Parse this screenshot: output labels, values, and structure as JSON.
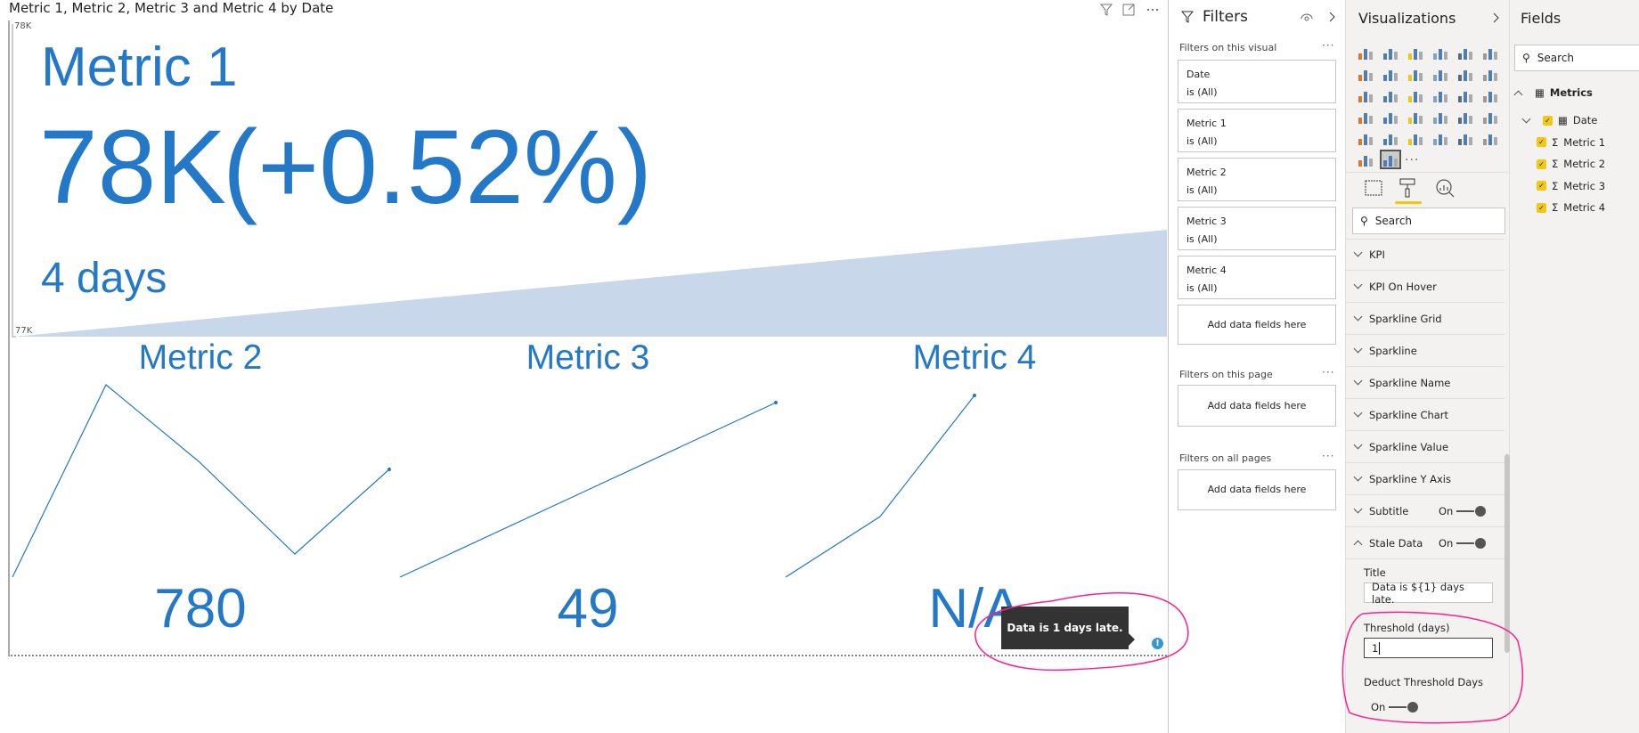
{
  "visual": {
    "title": "Metric 1, Metric 2, Metric 3 and Metric 4 by Date",
    "header_icons": [
      "filter-icon",
      "focus-mode-icon",
      "more-options-icon"
    ],
    "main_kpi": {
      "name": "Metric 1",
      "value": "78K",
      "change": "(+0.52%)",
      "subtitle": "4 days",
      "axis_max": "78K",
      "axis_min": "77K"
    },
    "sparklines": [
      {
        "name": "Metric 2",
        "value": "780"
      },
      {
        "name": "Metric 3",
        "value": "49"
      },
      {
        "name": "Metric 4",
        "value": "N/A"
      }
    ],
    "tooltip": "Data is 1 days late.",
    "stale_icon": "info-icon",
    "accent_color": "#2378c8",
    "area_color": "#c8d8ea",
    "annotation_color": "#ff1e8c"
  },
  "filters": {
    "title": "Filters",
    "on_visual_label": "Filters on this visual",
    "cards": [
      {
        "field": "Date",
        "state": "is (All)"
      },
      {
        "field": "Metric 1",
        "state": "is (All)"
      },
      {
        "field": "Metric 2",
        "state": "is (All)"
      },
      {
        "field": "Metric 3",
        "state": "is (All)"
      },
      {
        "field": "Metric 4",
        "state": "is (All)"
      }
    ],
    "add_fields": "Add data fields here",
    "on_page_label": "Filters on this page",
    "on_all_pages_label": "Filters on all pages",
    "more": "···"
  },
  "visualizations": {
    "title": "Visualizations",
    "more": "···",
    "icons": [
      "stacked-bar",
      "stacked-column",
      "clustered-bar",
      "clustered-column",
      "100-bar",
      "100-column",
      "line",
      "area",
      "stacked-area",
      "line-column",
      "line-clustered",
      "ribbon",
      "waterfall",
      "scatter",
      "pie",
      "donut",
      "treemap",
      "map",
      "filled-map",
      "funnel",
      "gauge",
      "card",
      "multi-row-card",
      "kpi",
      "slicer",
      "python",
      "table",
      "matrix",
      "r-script",
      "key-influencers",
      "arcgis",
      "custom-sparkline"
    ],
    "search_placeholder": "Search",
    "sections": [
      "KPI",
      "KPI On Hover",
      "Sparkline Grid",
      "Sparkline",
      "Sparkline Name",
      "Sparkline Chart",
      "Sparkline Value",
      "Sparkline Y Axis"
    ],
    "subtitle": {
      "label": "Subtitle",
      "toggle": "On"
    },
    "stale": {
      "label": "Stale Data",
      "toggle": "On",
      "title_label": "Title",
      "title_value": "Data is ${1} days late.",
      "threshold_label": "Threshold (days)",
      "threshold_value": "1",
      "deduct_label": "Deduct Threshold Days",
      "deduct_toggle": "On"
    }
  },
  "fields": {
    "title": "Fields",
    "search_placeholder": "Search",
    "table": "Metrics",
    "items": [
      "Date",
      "Metric 1",
      "Metric 2",
      "Metric 3",
      "Metric 4"
    ]
  }
}
